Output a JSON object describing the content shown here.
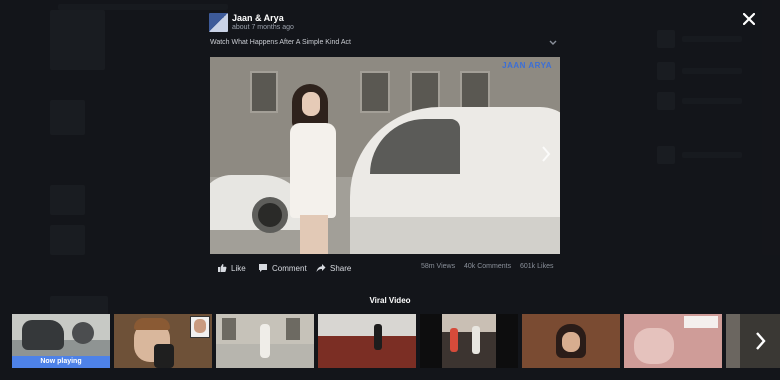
{
  "post": {
    "author": "Jaan & Arya",
    "time": "about 7 months ago",
    "title": "Watch What Happens After A Simple Kind Act"
  },
  "video": {
    "watermark": "JAAN ARYA",
    "next_icon": "chevron-right-icon"
  },
  "actions": {
    "like": "Like",
    "comment": "Comment",
    "share": "Share"
  },
  "stats": {
    "views": "58m Views",
    "comments": "40k Comments",
    "likes": "601k Likes"
  },
  "section": {
    "title": "Viral Video",
    "now_playing": "Now playing"
  },
  "colors": {
    "accent": "#4e82e8",
    "overlay": "#1c1e24"
  },
  "icons": [
    "close-icon",
    "chevron-down-icon",
    "like-icon",
    "comment-icon",
    "share-icon",
    "chevron-right-icon"
  ]
}
